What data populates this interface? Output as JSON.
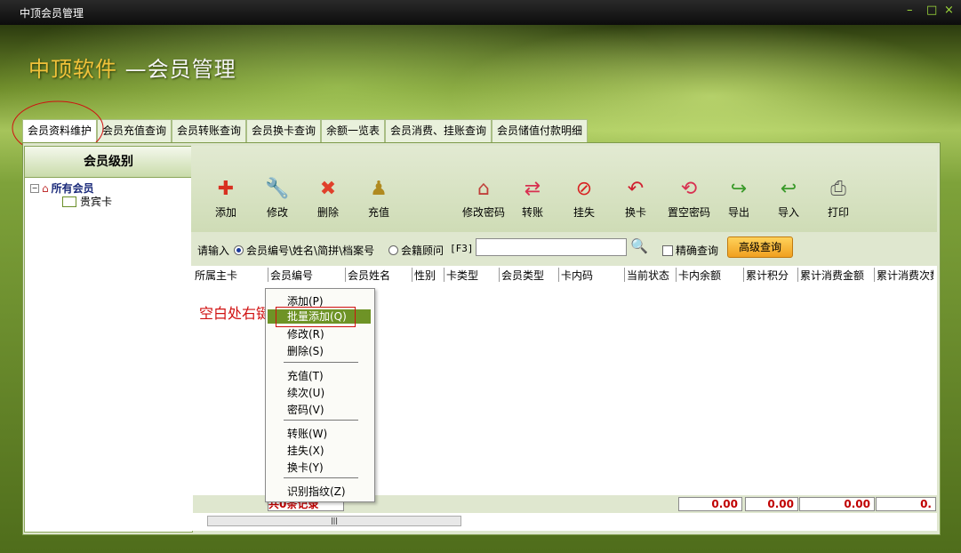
{
  "window": {
    "title": "中顶会员管理",
    "controls": [
      "–",
      "□",
      "×"
    ]
  },
  "header": {
    "brand": "中顶软件",
    "subtitle": "—会员管理"
  },
  "tabs": [
    "会员资料维护",
    "会员充值查询",
    "会员转账查询",
    "会员换卡查询",
    "余额一览表",
    "会员消费、挂账查询",
    "会员储值付款明细"
  ],
  "left": {
    "title": "会员级别",
    "root": "所有会员",
    "child": "贵宾卡"
  },
  "toolbar": {
    "add": "添加",
    "edit": "修改",
    "delete": "删除",
    "recharge": "充值",
    "change_password": "修改密码",
    "transfer": "转账",
    "report_loss": "挂失",
    "swap_card": "换卡",
    "clear_password": "置空密码",
    "export": "导出",
    "import": "导入",
    "print": "打印"
  },
  "search": {
    "prompt": "请输入",
    "radio1": "会员编号\\姓名\\简拼\\档案号",
    "radio2": "会籍顾问",
    "hotkey": "[F3]",
    "value": "",
    "exact": "精确查询",
    "advanced": "高级查询"
  },
  "grid": {
    "columns": [
      "所属主卡",
      "会员编号",
      "会员姓名",
      "性别",
      "卡类型",
      "会员类型",
      "卡内码",
      "当前状态",
      "卡内余额",
      "累计积分",
      "累计消费金额",
      "累计消费次数"
    ],
    "footer_count": "共0条记录",
    "sum1": "0.00",
    "sum2": "0.00",
    "sum3": "0.00",
    "sum4": "0."
  },
  "annotation": "空白处右键",
  "context_menu": {
    "add": "添加(P)",
    "batch_add": "批量添加(Q)",
    "edit": "修改(R)",
    "delete": "删除(S)",
    "recharge": "充值(T)",
    "renew": "续次(U)",
    "password": "密码(V)",
    "transfer": "转账(W)",
    "report_loss": "挂失(X)",
    "swap_card": "换卡(Y)",
    "fingerprint": "识别指纹(Z)"
  }
}
